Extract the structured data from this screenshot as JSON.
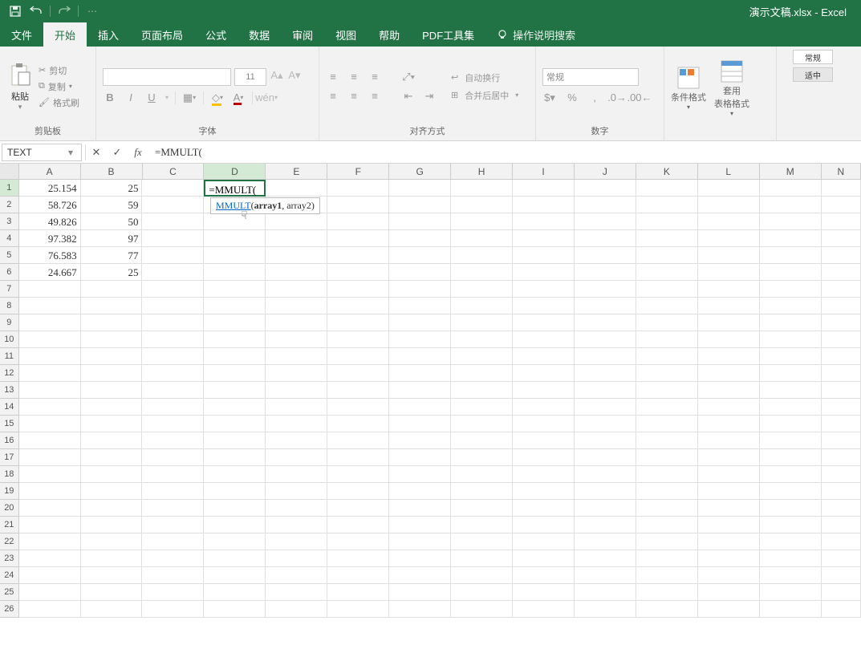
{
  "title": "演示文稿.xlsx  -  Excel",
  "menus": {
    "file": "文件",
    "home": "开始",
    "insert": "插入",
    "layout": "页面布局",
    "formula": "公式",
    "data": "数据",
    "review": "审阅",
    "view": "视图",
    "help": "帮助",
    "pdf": "PDF工具集",
    "tellme": "操作说明搜索"
  },
  "ribbon": {
    "clipboard": {
      "paste": "粘贴",
      "cut": "剪切",
      "copy": "复制",
      "format_painter": "格式刷",
      "label": "剪贴板"
    },
    "font": {
      "size": "11",
      "label": "字体"
    },
    "alignment": {
      "wrap": "自动换行",
      "merge": "合并后居中",
      "label": "对齐方式"
    },
    "number": {
      "general": "常规",
      "label": "数字"
    },
    "styles": {
      "cond": "条件格式",
      "table": "套用\n表格格式",
      "normal": "常规",
      "mid": "适中"
    }
  },
  "namebox": "TEXT",
  "formula": "=MMULT(",
  "tooltip": {
    "fn": "MMULT",
    "sig_bold": "array1",
    "sig_rest": ", array2)"
  },
  "columns": [
    "A",
    "B",
    "C",
    "D",
    "E",
    "F",
    "G",
    "H",
    "I",
    "J",
    "K",
    "L",
    "M",
    "N"
  ],
  "col_widths": [
    "wA",
    "wB",
    "wC",
    "wD",
    "wE",
    "wF",
    "wG",
    "wH",
    "wI",
    "wJ",
    "wK",
    "wL",
    "wM",
    "wN"
  ],
  "active_col": "D",
  "active_row": 1,
  "row_count": 26,
  "cells": {
    "A1": "25.154",
    "B1": "25",
    "D1": "=MMULT(",
    "A2": "58.726",
    "B2": "59",
    "A3": "49.826",
    "B3": "50",
    "A4": "97.382",
    "B4": "97",
    "A5": "76.583",
    "B5": "77",
    "A6": "24.667",
    "B6": "25"
  }
}
